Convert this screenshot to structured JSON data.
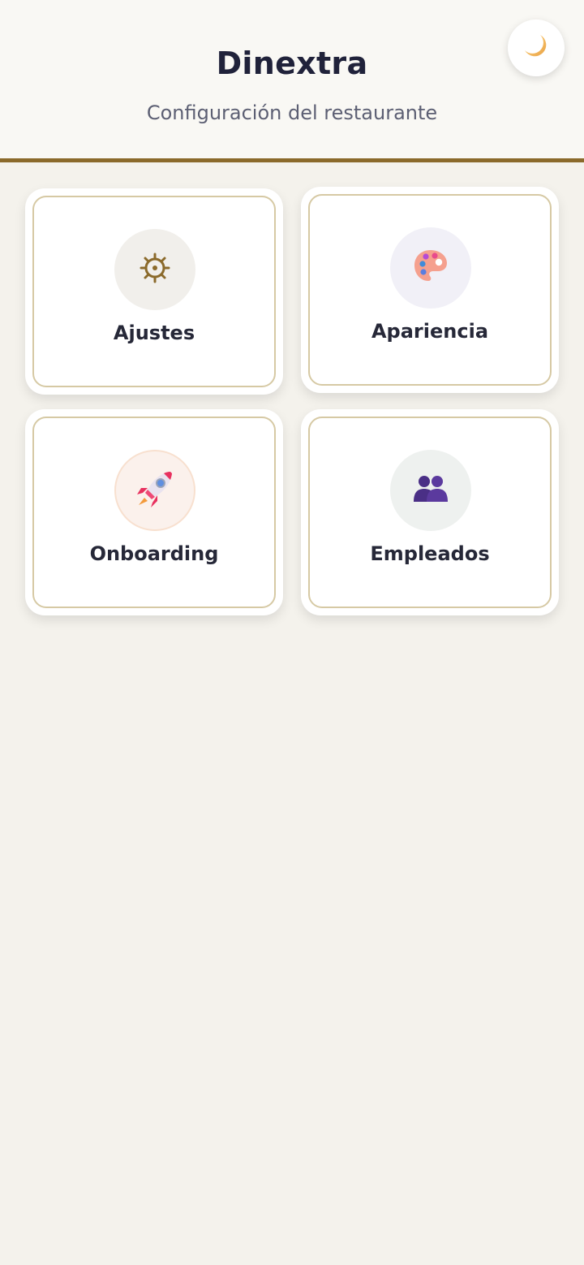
{
  "header": {
    "title": "Dinextra",
    "subtitle": "Configuración del restaurante",
    "theme_toggle_icon": "moon-icon"
  },
  "colors": {
    "accent": "#8b6a2b",
    "background": "#f4f2ec",
    "card_border": "#d6c9a4",
    "text_primary": "#262838"
  },
  "menu": {
    "items": [
      {
        "label": "Ajustes",
        "icon": "gear-icon"
      },
      {
        "label": "Apariencia",
        "icon": "palette-icon"
      },
      {
        "label": "Onboarding",
        "icon": "rocket-icon"
      },
      {
        "label": "Empleados",
        "icon": "people-icon"
      }
    ]
  }
}
